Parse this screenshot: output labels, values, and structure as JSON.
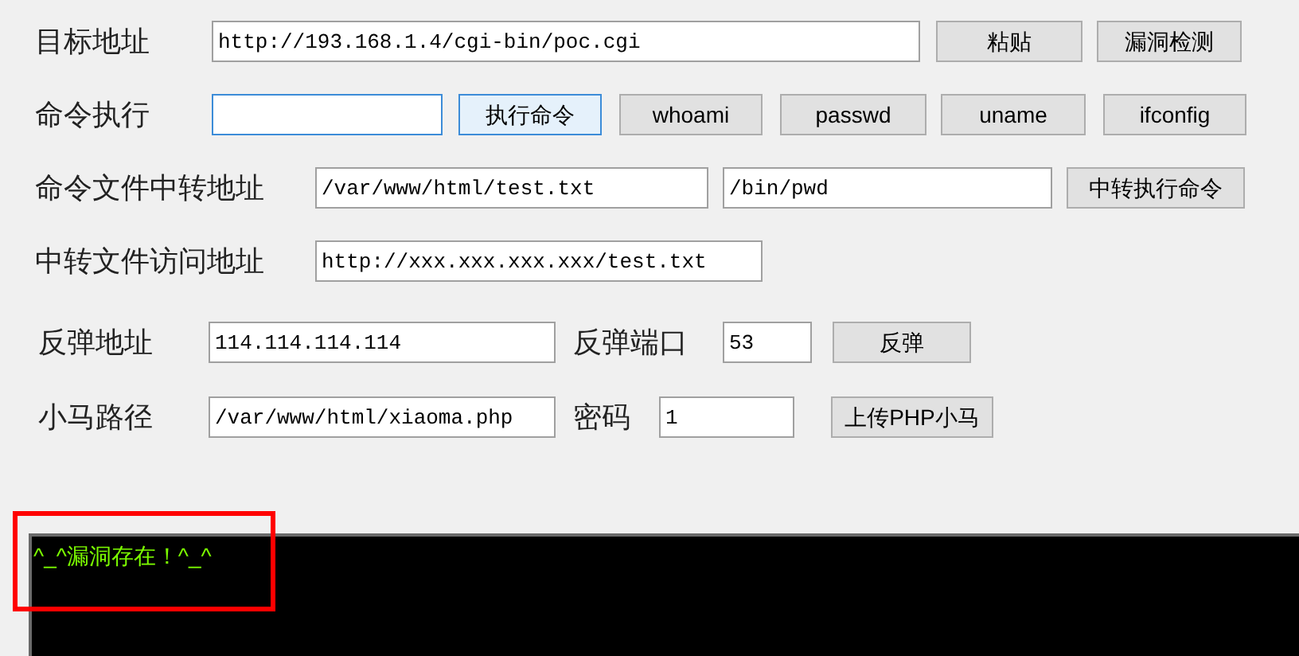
{
  "rows": [
    {
      "items": [
        {
          "kind": "label",
          "text": "目标地址"
        },
        {
          "kind": "input",
          "value": "http://193.168.1.4/cgi-bin/poc.cgi",
          "focused": false
        },
        {
          "kind": "button",
          "label": "粘贴",
          "focused": false
        },
        {
          "kind": "button",
          "label": "漏洞检测",
          "focused": false
        }
      ]
    },
    {
      "items": [
        {
          "kind": "label",
          "text": "命令执行"
        },
        {
          "kind": "input",
          "value": "",
          "focused": true
        },
        {
          "kind": "button",
          "label": "执行命令",
          "focused": true
        },
        {
          "kind": "button",
          "label": "whoami",
          "focused": false
        },
        {
          "kind": "button",
          "label": "passwd",
          "focused": false
        },
        {
          "kind": "button",
          "label": "uname",
          "focused": false
        },
        {
          "kind": "button",
          "label": "ifconfig",
          "focused": false
        }
      ]
    },
    {
      "items": [
        {
          "kind": "label",
          "text": "命令文件中转地址"
        },
        {
          "kind": "input",
          "value": "/var/www/html/test.txt",
          "focused": false
        },
        {
          "kind": "input",
          "value": "/bin/pwd",
          "focused": false
        },
        {
          "kind": "button",
          "label": "中转执行命令",
          "focused": false
        }
      ]
    },
    {
      "items": [
        {
          "kind": "label",
          "text": "中转文件访问地址"
        },
        {
          "kind": "input",
          "value": "http://xxx.xxx.xxx.xxx/test.txt",
          "focused": false
        }
      ]
    },
    {
      "items": [
        {
          "kind": "label",
          "text": "反弹地址"
        },
        {
          "kind": "input",
          "value": "114.114.114.114",
          "focused": false
        },
        {
          "kind": "label",
          "text": "反弹端口"
        },
        {
          "kind": "input",
          "value": "53",
          "focused": false
        },
        {
          "kind": "button",
          "label": "反弹",
          "focused": false
        }
      ]
    },
    {
      "items": [
        {
          "kind": "label",
          "text": "小马路径"
        },
        {
          "kind": "input",
          "value": "/var/www/html/xiaoma.php",
          "focused": false
        },
        {
          "kind": "label",
          "text": "密码"
        },
        {
          "kind": "input",
          "value": "1",
          "focused": false
        },
        {
          "kind": "button",
          "label": "上传PHP小马",
          "focused": false
        }
      ]
    }
  ],
  "console": {
    "lines": [
      "^_^漏洞存在！^_^"
    ],
    "highlighted": true
  }
}
